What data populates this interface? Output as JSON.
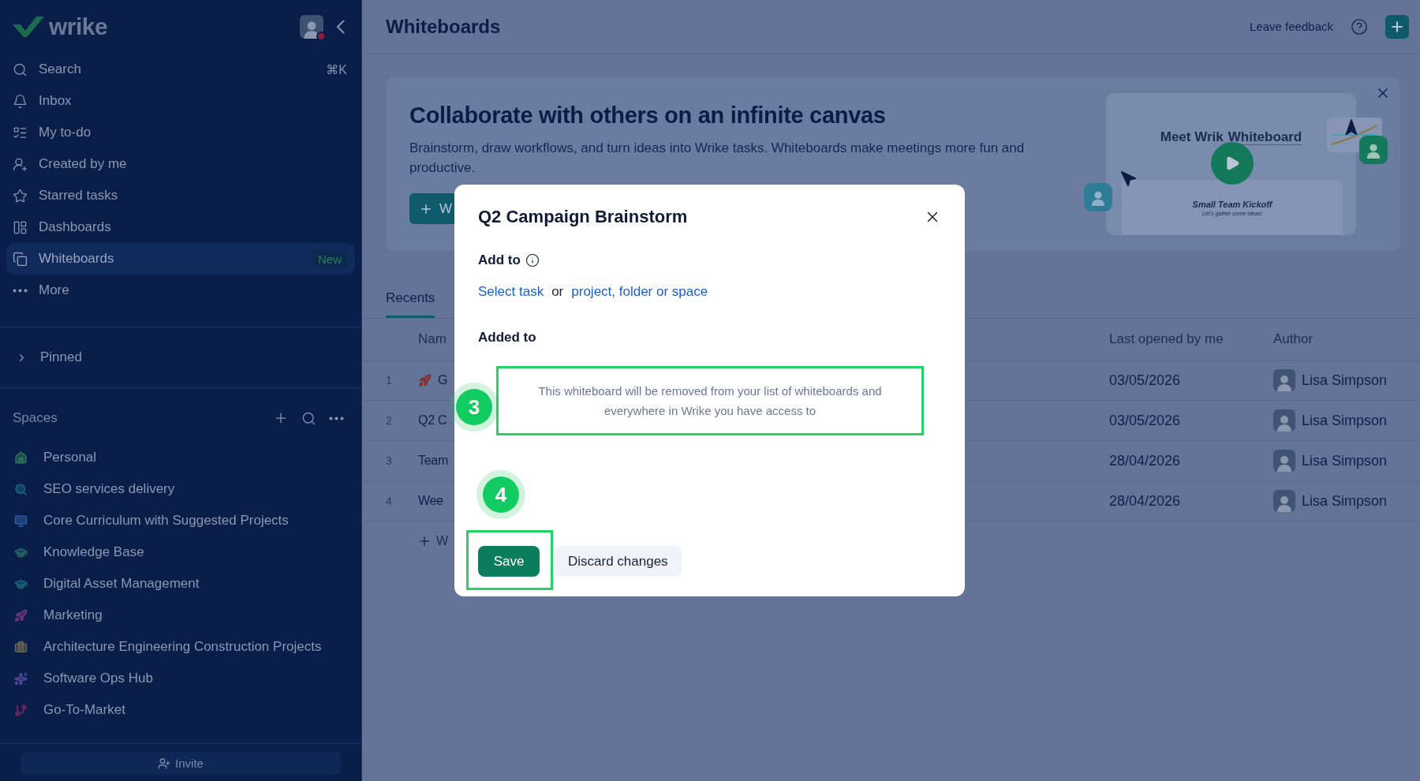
{
  "sidebar": {
    "logo": "wrike",
    "nav": [
      {
        "label": "Search",
        "shortcut": "⌘K",
        "selected": false
      },
      {
        "label": "Inbox",
        "selected": false
      },
      {
        "label": "My to-do",
        "selected": false
      },
      {
        "label": "Created by me",
        "selected": false
      },
      {
        "label": "Starred tasks",
        "selected": false
      },
      {
        "label": "Dashboards",
        "selected": false
      },
      {
        "label": "Whiteboards",
        "badge": "New",
        "selected": true
      },
      {
        "label": "More",
        "selected": false
      }
    ],
    "pinned": {
      "label": "Pinned",
      "expanded": false
    },
    "spaces": {
      "title": "Spaces",
      "items": [
        {
          "label": "Personal"
        },
        {
          "label": "SEO services delivery"
        },
        {
          "label": "Core Curriculum with Suggested Projects"
        },
        {
          "label": "Knowledge Base"
        },
        {
          "label": "Digital Asset Management"
        },
        {
          "label": "Marketing"
        },
        {
          "label": "Architecture Engineering Construction Projects"
        },
        {
          "label": "Software Ops Hub"
        },
        {
          "label": "Go-To-Market"
        }
      ]
    },
    "invite": "Invite"
  },
  "header": {
    "title": "Whiteboards",
    "feedback": "Leave feedback"
  },
  "banner": {
    "title": "Collaborate with others on an infinite canvas",
    "description": "Brainstorm, draw workflows, and turn ideas into Wrike tasks. Whiteboards make meetings more fun and productive.",
    "button": "W",
    "preview": {
      "headline_start": "Meet Wrik",
      "headline_end": "Whiteboard",
      "board_title": "Small Team Kickoff",
      "board_subtitle": "Let's gather some ideas!"
    }
  },
  "tabs": [
    {
      "label": "Recents",
      "selected": true
    }
  ],
  "table": {
    "columns": [
      "Nam",
      "Last opened by me",
      "Author"
    ],
    "rows": [
      {
        "index": "1",
        "kind": "rocket",
        "name": "G",
        "opened": "03/05/2026",
        "author": "Lisa Simpson"
      },
      {
        "index": "2",
        "kind": "plain",
        "name": "Q2 C",
        "opened": "03/05/2026",
        "author": "Lisa Simpson"
      },
      {
        "index": "3",
        "kind": "plain",
        "name": "Team",
        "opened": "28/04/2026",
        "author": "Lisa Simpson"
      },
      {
        "index": "4",
        "kind": "plain",
        "name": "Wee",
        "opened": "28/04/2026",
        "author": "Lisa Simpson"
      }
    ],
    "add_row": "W"
  },
  "dialog": {
    "title": "Q2 Campaign Brainstorm",
    "add_to_label": "Add to",
    "link_task": "Select task",
    "or": "or",
    "link_location": "project, folder or space",
    "added_to_label": "Added to",
    "notice": "This whiteboard will be removed from your list of whiteboards and everywhere in Wrike you have access to",
    "save": "Save",
    "discard": "Discard changes"
  },
  "annotations": [
    {
      "number": "3"
    },
    {
      "number": "4"
    }
  ]
}
